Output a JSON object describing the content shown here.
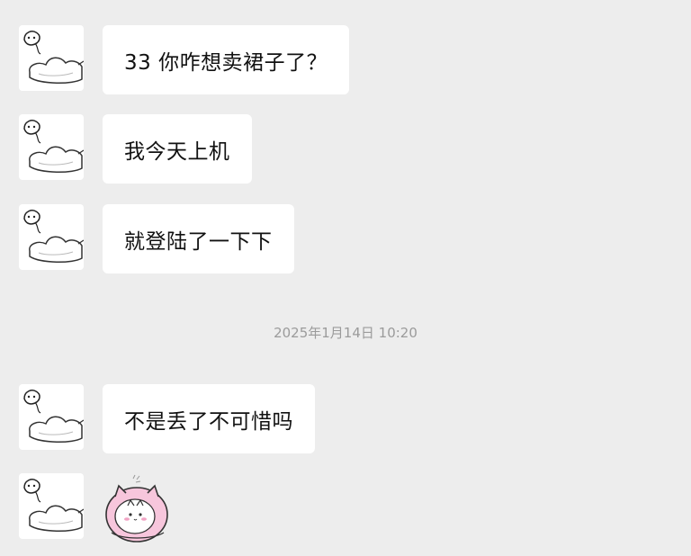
{
  "messages": [
    {
      "text": "33 你咋想卖裙子了？"
    },
    {
      "text": "我今天上机"
    },
    {
      "text": "就登陆了一下下"
    },
    {
      "text": "不是丢了不可惜吗"
    }
  ],
  "timestamp": "2025年1月14日 10:20",
  "icons": {
    "avatar": "ghost-cat-avatar-icon",
    "sticker": "pink-cat-sticker-icon"
  },
  "colors": {
    "background": "#ededed",
    "bubble": "#ffffff",
    "text": "#111111",
    "timestamp": "#9b9b9b",
    "sticker_pink": "#f2b8d2"
  }
}
